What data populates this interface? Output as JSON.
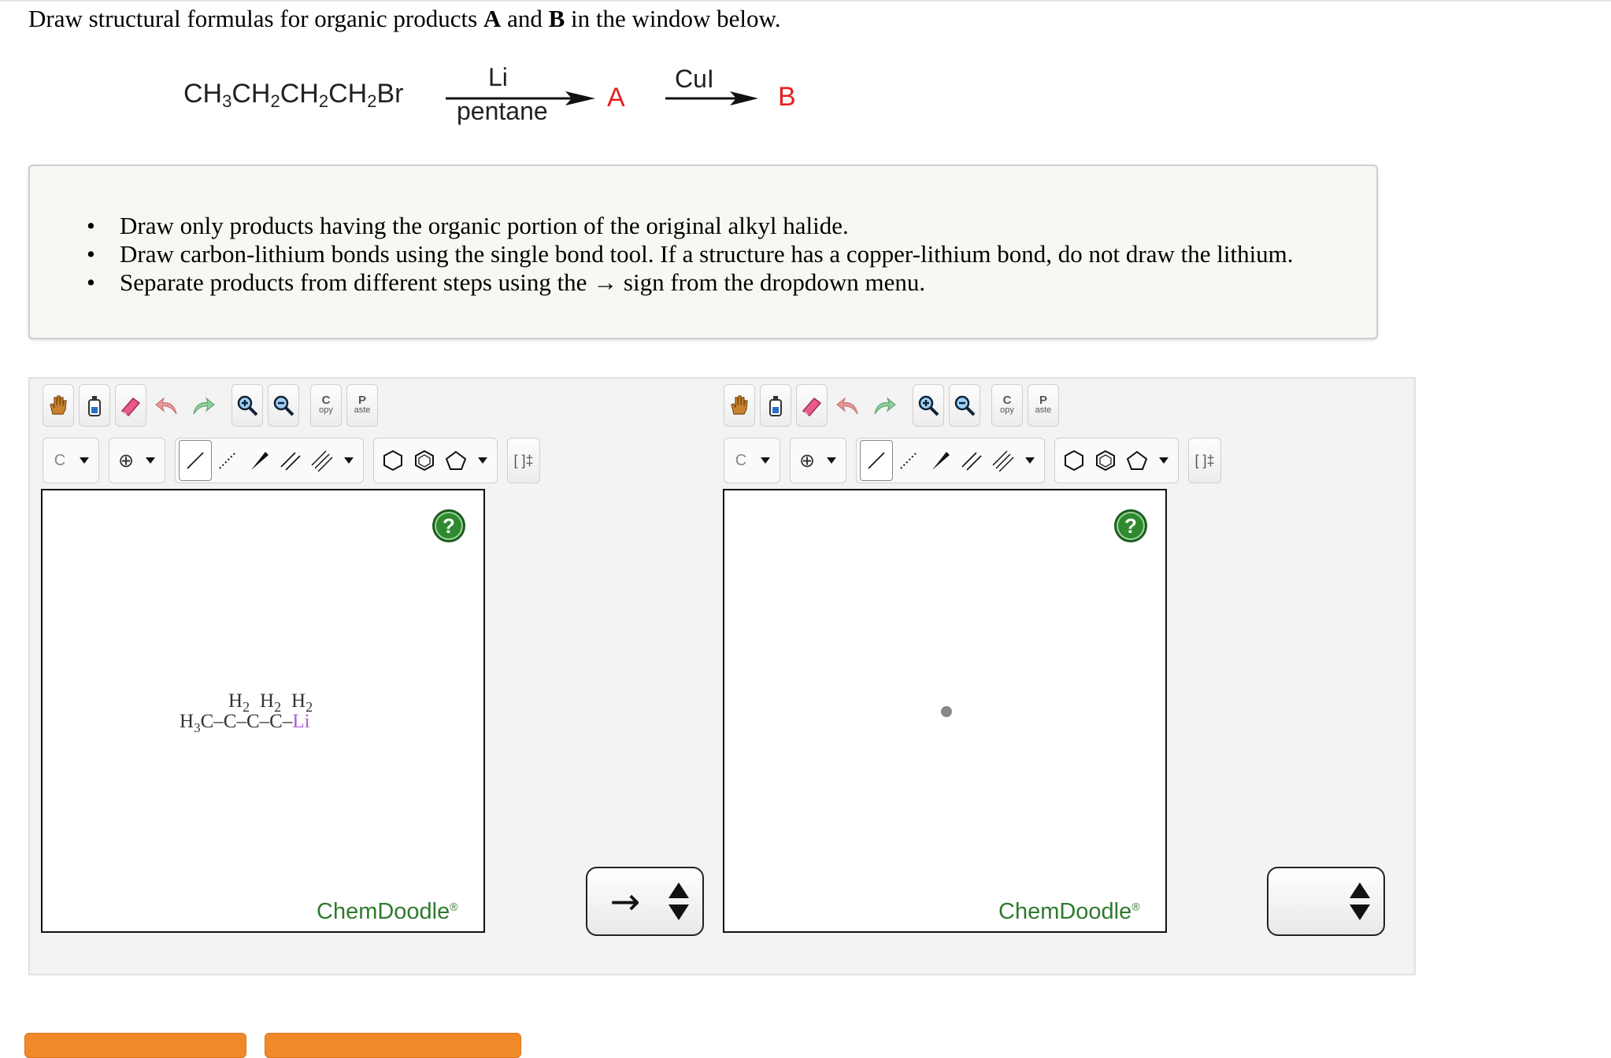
{
  "question": {
    "text_before": "Draw structural formulas for organic products ",
    "label_a": "A",
    "text_and": " and ",
    "label_b": "B",
    "text_after": " in the window below."
  },
  "reaction": {
    "reactant_parts": [
      "CH",
      "3",
      "CH",
      "2",
      "CH",
      "2",
      "CH",
      "2",
      "Br"
    ],
    "step1_top": "Li",
    "step1_bottom": "pentane",
    "product_a": "A",
    "step2_top": "CuI",
    "product_b": "B",
    "product_color": "#e52020"
  },
  "instructions": [
    "Draw only products having the organic portion of the original alkyl halide.",
    "Draw carbon-lithium bonds using the single bond tool. If a structure has a copper-lithium bond, do not draw the lithium.",
    "Separate products from different steps using the → sign from the dropdown menu."
  ],
  "toolbar": {
    "icons_row1": [
      "hand-icon",
      "clear-icon",
      "eraser-icon",
      "undo-icon",
      "redo-icon",
      "zoom-in-icon",
      "zoom-out-icon"
    ],
    "copy_top": "C",
    "copy_bottom": "opy",
    "paste_top": "P",
    "paste_bottom": "aste",
    "atom_label": "C",
    "charge_symbol": "⊕",
    "bracket_label": "[ ]‡"
  },
  "editor_left": {
    "help_label": "?",
    "brand": "ChemDoodle",
    "brand_mark": "®",
    "molecule": {
      "h_labels": [
        "H2",
        "H2",
        "H2"
      ],
      "chain": [
        "H3C",
        "C",
        "C",
        "C",
        "Li"
      ],
      "li_color": "#b05cd6"
    },
    "stepper_value": "→"
  },
  "editor_right": {
    "help_label": "?",
    "brand": "ChemDoodle",
    "brand_mark": "®",
    "stepper_value": ""
  },
  "colors": {
    "brand_green": "#2f7a2f",
    "orange": "#f08a28"
  }
}
